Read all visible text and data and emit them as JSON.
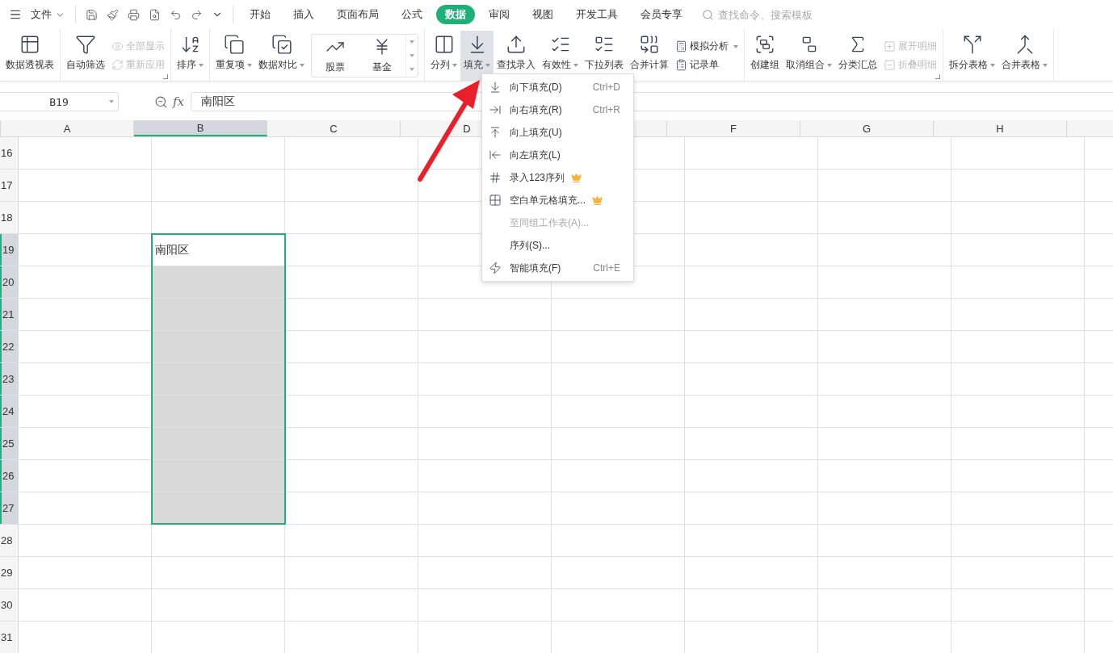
{
  "menu_bar": {
    "file_label": "文件",
    "tabs": [
      {
        "label": "开始",
        "selected": false
      },
      {
        "label": "插入",
        "selected": false
      },
      {
        "label": "页面布局",
        "selected": false
      },
      {
        "label": "公式",
        "selected": false
      },
      {
        "label": "数据",
        "selected": true
      },
      {
        "label": "审阅",
        "selected": false
      },
      {
        "label": "视图",
        "selected": false
      },
      {
        "label": "开发工具",
        "selected": false
      },
      {
        "label": "会员专享",
        "selected": false
      }
    ],
    "search": {
      "placeholder": "查找命令、搜索模板"
    }
  },
  "ribbon": {
    "groups": [
      {
        "items": [
          {
            "kind": "big",
            "label": "数据透视表",
            "selected": false
          }
        ]
      },
      {
        "launcher": true,
        "items": [
          {
            "kind": "big",
            "label": "自动筛选",
            "selected": false
          },
          {
            "kind": "stack",
            "entries": [
              {
                "label": "全部显示",
                "disabled": true
              },
              {
                "label": "重新应用",
                "disabled": true
              }
            ]
          }
        ]
      },
      {
        "items": [
          {
            "kind": "big",
            "label": "排序",
            "dropdown": true,
            "selected": false
          }
        ]
      },
      {
        "items": [
          {
            "kind": "big",
            "label": "重复项",
            "dropdown": true,
            "selected": false
          },
          {
            "kind": "big",
            "label": "数据对比",
            "dropdown": true,
            "selected": false
          },
          {
            "kind": "gallery",
            "entries": [
              {
                "label": "股票"
              },
              {
                "label": "基金"
              }
            ]
          }
        ]
      },
      {
        "items": [
          {
            "kind": "big",
            "label": "分列",
            "dropdown": true,
            "selected": false
          },
          {
            "kind": "big",
            "label": "填充",
            "dropdown": true,
            "selected": true
          },
          {
            "kind": "big",
            "label": "查找录入",
            "selected": false
          },
          {
            "kind": "big",
            "label": "有效性",
            "dropdown": true,
            "selected": false
          },
          {
            "kind": "big",
            "label": "下拉列表",
            "selected": false
          },
          {
            "kind": "big",
            "label": "合并计算",
            "selected": false
          },
          {
            "kind": "stack",
            "entries": [
              {
                "label": "模拟分析",
                "disabled": false,
                "dropdown": true
              },
              {
                "label": "记录单",
                "disabled": false
              }
            ]
          }
        ]
      },
      {
        "launcher": true,
        "items": [
          {
            "kind": "big",
            "label": "创建组",
            "selected": false
          },
          {
            "kind": "big",
            "label": "取消组合",
            "dropdown": true,
            "selected": false
          },
          {
            "kind": "big",
            "label": "分类汇总",
            "selected": false
          },
          {
            "kind": "stack",
            "entries": [
              {
                "label": "展开明细",
                "disabled": true
              },
              {
                "label": "折叠明细",
                "disabled": true
              }
            ]
          }
        ]
      },
      {
        "items": [
          {
            "kind": "big",
            "label": "拆分表格",
            "dropdown": true,
            "selected": false
          },
          {
            "kind": "big",
            "label": "合并表格",
            "dropdown": true,
            "selected": false
          }
        ]
      }
    ]
  },
  "formula_bar": {
    "name_box": "B19",
    "fx_label": "fx",
    "formula": "南阳区"
  },
  "sheet": {
    "columns": [
      {
        "label": "A",
        "selected": false
      },
      {
        "label": "B",
        "selected": true
      },
      {
        "label": "C",
        "selected": false
      },
      {
        "label": "D",
        "selected": false
      },
      {
        "selected": false
      },
      {
        "label": "F",
        "selected": false
      },
      {
        "label": "G",
        "selected": false
      },
      {
        "label": "H",
        "selected": false
      }
    ],
    "rows": [
      {
        "number": "16",
        "selected": false
      },
      {
        "number": "17",
        "selected": false
      },
      {
        "number": "18",
        "selected": false
      },
      {
        "number": "19",
        "selected": true,
        "value": "南阳区"
      },
      {
        "number": "20",
        "selected": true
      },
      {
        "number": "21",
        "selected": true
      },
      {
        "number": "22",
        "selected": true
      },
      {
        "number": "23",
        "selected": true
      },
      {
        "number": "24",
        "selected": true
      },
      {
        "number": "25",
        "selected": true
      },
      {
        "number": "26",
        "selected": true
      },
      {
        "number": "27",
        "selected": true
      },
      {
        "number": "28",
        "selected": false
      },
      {
        "number": "29",
        "selected": false
      },
      {
        "number": "30",
        "selected": false
      },
      {
        "number": "31",
        "selected": false
      }
    ]
  },
  "fill_menu": {
    "items": [
      {
        "label": "向下填充(D)",
        "shortcut": "Ctrl+D",
        "disabled": false,
        "premium": false
      },
      {
        "label": "向右填充(R)",
        "shortcut": "Ctrl+R",
        "disabled": false,
        "premium": false
      },
      {
        "label": "向上填充(U)",
        "disabled": false,
        "premium": false
      },
      {
        "label": "向左填充(L)",
        "disabled": false,
        "premium": false
      },
      {
        "label": "录入123序列",
        "disabled": false,
        "premium": true
      },
      {
        "label": "空白单元格填充...",
        "disabled": false,
        "premium": true
      },
      {
        "label": "至同组工作表(A)...",
        "disabled": true,
        "premium": false
      },
      {
        "label": "序列(S)...",
        "disabled": false,
        "premium": false
      },
      {
        "label": "智能填充(F)",
        "shortcut": "Ctrl+E",
        "disabled": false,
        "premium": false
      }
    ]
  }
}
